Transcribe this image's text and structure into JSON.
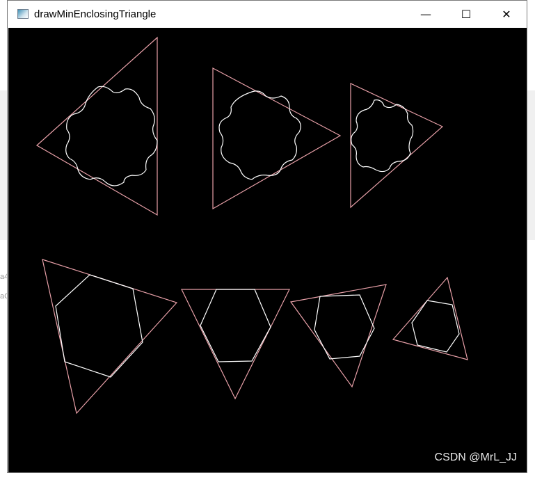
{
  "window": {
    "title": "drawMinEnclosingTriangle",
    "icon": "opencv-window-icon",
    "controls": {
      "minimize": "—",
      "maximize": "☐",
      "close": "✕"
    }
  },
  "canvas": {
    "background": "#000000",
    "triangle_color": "#e8a0a8",
    "contour_color": "#ffffff"
  },
  "background_hint": {
    "line1": "a4",
    "line2": "aC"
  },
  "watermark": "CSDN @MrL_JJ"
}
